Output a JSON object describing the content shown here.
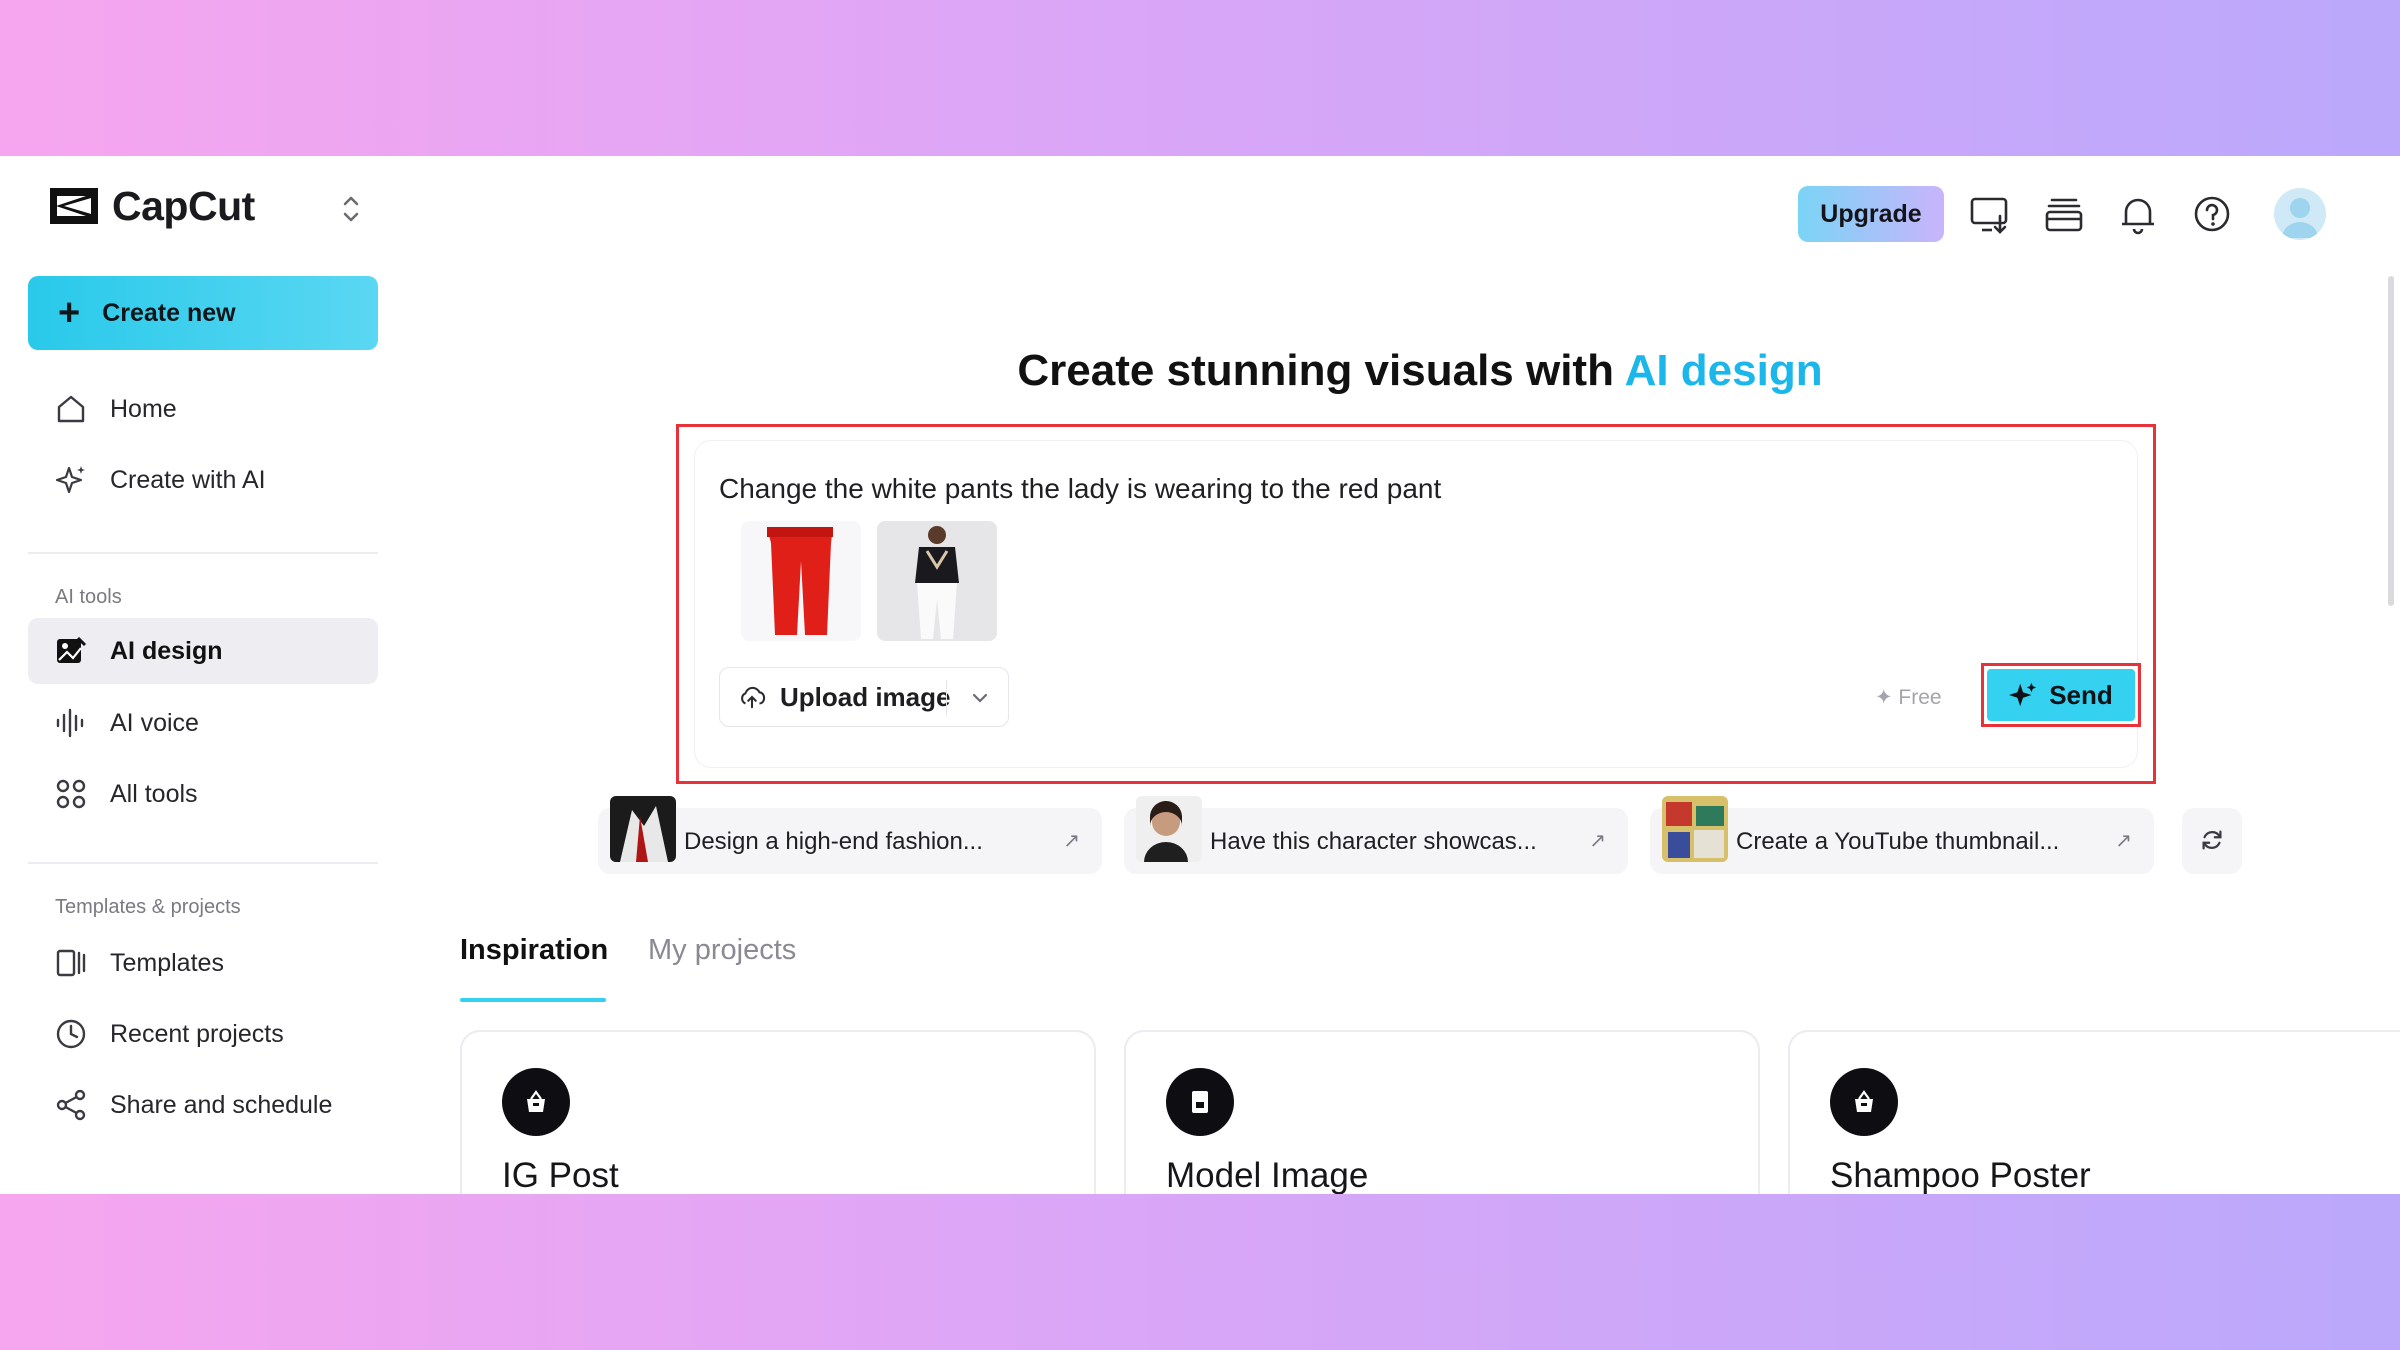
{
  "app": {
    "name": "CapCut"
  },
  "sidebar": {
    "create_new": "Create new",
    "nav_top": [
      {
        "label": "Home",
        "icon": "home-icon"
      },
      {
        "label": "Create with AI",
        "icon": "sparkle-icon"
      }
    ],
    "ai_tools_label": "AI tools",
    "ai_tools": [
      {
        "label": "AI design",
        "icon": "image-pencil-icon",
        "active": true
      },
      {
        "label": "AI voice",
        "icon": "waveform-icon"
      },
      {
        "label": "All tools",
        "icon": "grid-icon"
      }
    ],
    "templates_label": "Templates & projects",
    "templates_items": [
      {
        "label": "Templates",
        "icon": "templates-icon"
      },
      {
        "label": "Recent projects",
        "icon": "clock-icon"
      },
      {
        "label": "Share and schedule",
        "icon": "share-icon"
      }
    ]
  },
  "topbar": {
    "upgrade": "Upgrade",
    "icons": [
      "download-desktop-icon",
      "stack-icon",
      "bell-icon",
      "help-icon"
    ]
  },
  "main": {
    "headline_prefix": "Create stunning visuals with ",
    "headline_accent": "AI design",
    "prompt": {
      "text": "Change the white pants the lady is wearing to the red pant",
      "attachments": [
        "red-pants-thumbnail",
        "lady-white-pants-thumbnail"
      ],
      "upload_label": "Upload image",
      "free_label": "✦ Free",
      "send_label": "Send"
    },
    "suggestions": [
      {
        "text": "Design a high-end fashion...",
        "arrow": "↗"
      },
      {
        "text": "Have this character showcas...",
        "arrow": "↗"
      },
      {
        "text": "Create a YouTube thumbnail...",
        "arrow": "↗"
      }
    ],
    "tabs": [
      {
        "label": "Inspiration",
        "active": true
      },
      {
        "label": "My projects",
        "active": false
      }
    ],
    "cards": [
      {
        "title": "IG Post"
      },
      {
        "title": "Model Image"
      },
      {
        "title": "Shampoo Poster"
      }
    ]
  },
  "colors": {
    "accent": "#34d2f0",
    "highlight_border": "#e8323a",
    "headline_accent": "#1bb6ea"
  }
}
